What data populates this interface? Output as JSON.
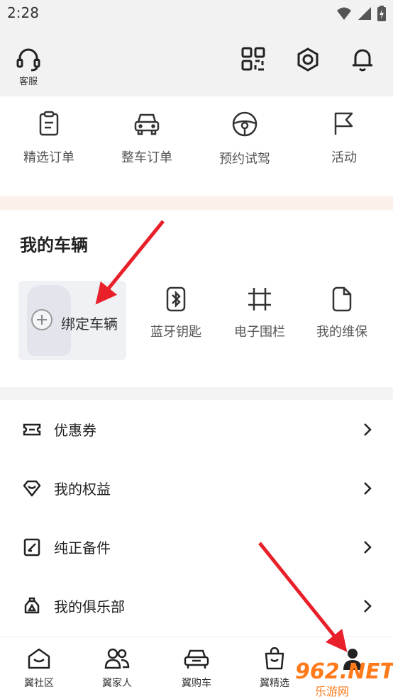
{
  "status": {
    "time": "2:28"
  },
  "header": {
    "service_label": "客服"
  },
  "quick_actions": [
    {
      "label": "精选订单",
      "icon": "clipboard-icon"
    },
    {
      "label": "整车订单",
      "icon": "car-front-icon"
    },
    {
      "label": "预约试驾",
      "icon": "steering-wheel-icon"
    },
    {
      "label": "活动",
      "icon": "flag-icon"
    }
  ],
  "vehicle": {
    "title": "我的车辆",
    "bind_label": "绑定车辆",
    "items": [
      {
        "label": "蓝牙钥匙",
        "icon": "bluetooth-key-icon"
      },
      {
        "label": "电子围栏",
        "icon": "geofence-icon"
      },
      {
        "label": "我的维保",
        "icon": "maintenance-icon"
      }
    ]
  },
  "menu": [
    {
      "label": "优惠券",
      "icon": "coupon-icon"
    },
    {
      "label": "我的权益",
      "icon": "benefits-icon"
    },
    {
      "label": "纯正备件",
      "icon": "parts-icon"
    },
    {
      "label": "我的俱乐部",
      "icon": "club-icon"
    }
  ],
  "bottom_nav": [
    {
      "label": "翼社区",
      "icon": "community-icon"
    },
    {
      "label": "翼家人",
      "icon": "family-icon"
    },
    {
      "label": "翼购车",
      "icon": "buy-car-icon"
    },
    {
      "label": "翼精选",
      "icon": "shopping-bag-icon"
    },
    {
      "label": "",
      "icon": "profile-icon"
    }
  ],
  "watermark": {
    "main": "962.NET",
    "sub": "乐游网"
  },
  "colors": {
    "arrow": "#e8202a",
    "watermark": "#ff7a1a"
  }
}
